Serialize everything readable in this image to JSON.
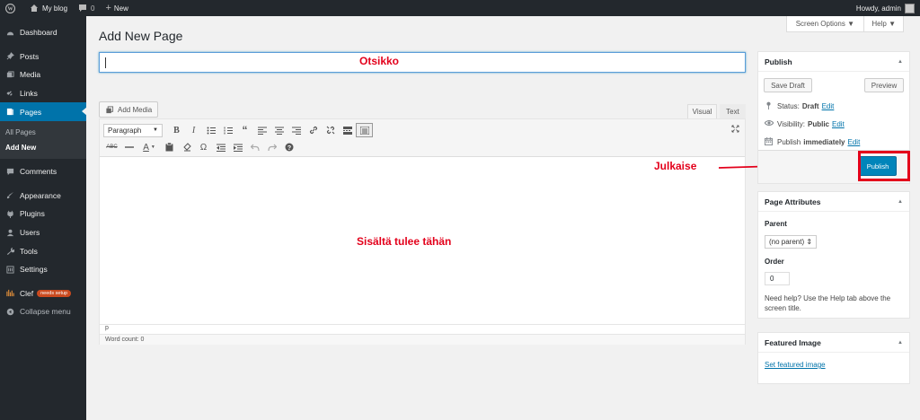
{
  "adminbar": {
    "site_name": "My blog",
    "comments_count": "0",
    "new_label": "New",
    "howdy": "Howdy, admin"
  },
  "sidebar": {
    "items": [
      {
        "label": "Dashboard",
        "icon": "dashboard-icon"
      },
      {
        "label": "Posts",
        "icon": "pin-icon"
      },
      {
        "label": "Media",
        "icon": "media-icon"
      },
      {
        "label": "Links",
        "icon": "link-icon"
      },
      {
        "label": "Pages",
        "icon": "page-icon"
      }
    ],
    "sub_items": [
      {
        "label": "All Pages"
      },
      {
        "label": "Add New"
      }
    ],
    "items2": [
      {
        "label": "Comments",
        "icon": "comment-icon"
      },
      {
        "label": "Appearance",
        "icon": "brush-icon"
      },
      {
        "label": "Plugins",
        "icon": "plugin-icon"
      },
      {
        "label": "Users",
        "icon": "users-icon"
      },
      {
        "label": "Tools",
        "icon": "wrench-icon"
      },
      {
        "label": "Settings",
        "icon": "settings-icon"
      },
      {
        "label": "Clef",
        "icon": "clef-icon",
        "badge": "needs setup"
      },
      {
        "label": "Collapse menu",
        "icon": "collapse-icon"
      }
    ]
  },
  "header": {
    "screen_options": "Screen Options ▼",
    "help": "Help ▼",
    "title": "Add New Page"
  },
  "annotations": {
    "title_hint": "Otsikko",
    "content_hint": "Sisältä tulee tähän",
    "publish_hint": "Julkaise",
    "annotation_color": "#e3001b"
  },
  "editor": {
    "add_media": "Add Media",
    "tab_visual": "Visual",
    "tab_text": "Text",
    "format": "Paragraph",
    "path": "p",
    "word_count": "Word count: 0"
  },
  "publish_box": {
    "title": "Publish",
    "save_draft": "Save Draft",
    "preview": "Preview",
    "status_label": "Status:",
    "status_value": "Draft",
    "visibility_label": "Visibility:",
    "visibility_value": "Public",
    "schedule_label": "Publish",
    "schedule_value": "immediately",
    "edit": "Edit",
    "publish_button": "Publish",
    "accent": "#0085ba"
  },
  "attributes_box": {
    "title": "Page Attributes",
    "parent_label": "Parent",
    "parent_value": "(no parent) ⇕",
    "order_label": "Order",
    "order_value": "0",
    "help": "Need help? Use the Help tab above the screen title."
  },
  "featured_box": {
    "title": "Featured Image",
    "link": "Set featured image"
  }
}
